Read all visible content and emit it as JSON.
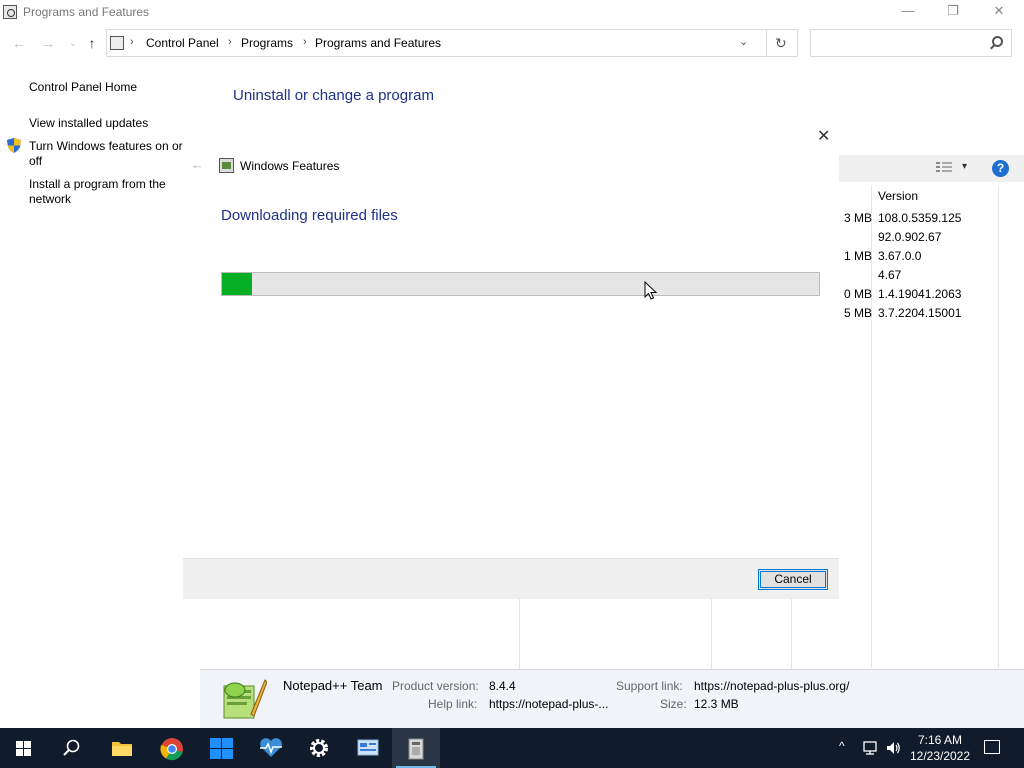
{
  "window": {
    "title": "Programs and Features",
    "minimize_glyph": "—",
    "maximize_glyph": "❐",
    "close_glyph": "✕"
  },
  "nav": {
    "back_glyph": "←",
    "forward_glyph": "→",
    "history_glyph": "⌄",
    "up_glyph": "↑"
  },
  "address": {
    "breadcrumbs": [
      "Control Panel",
      "Programs",
      "Programs and Features"
    ],
    "separator": "›",
    "dropdown_glyph": "⌄",
    "refresh_glyph": "↻"
  },
  "search": {
    "placeholder": "",
    "value": ""
  },
  "sidebar": {
    "items": [
      {
        "label": "Control Panel Home"
      },
      {
        "label": "View installed updates"
      },
      {
        "label": "Turn Windows features on or off",
        "icon": "shield-icon"
      },
      {
        "label": "Install a program from the network"
      }
    ]
  },
  "main": {
    "heading": "Uninstall or change a program",
    "columns": {
      "version": "Version"
    },
    "rows": [
      {
        "size": "3 MB",
        "version": "108.0.5359.125"
      },
      {
        "size": "",
        "version": "92.0.902.67"
      },
      {
        "size": "1 MB",
        "version": "3.67.0.0"
      },
      {
        "size": "",
        "version": "4.67"
      },
      {
        "size": "0 MB",
        "version": "1.4.19041.2063"
      },
      {
        "size": "5 MB",
        "version": "3.7.2204.15001"
      }
    ],
    "help_glyph": "?",
    "view_dropdown_glyph": "▾"
  },
  "dialog": {
    "title": "Windows Features",
    "heading": "Downloading required files",
    "progress_percent": 5,
    "cancel_label": "Cancel",
    "close_glyph": "✕",
    "back_glyph": "←"
  },
  "details": {
    "publisher": "Notepad++ Team",
    "product_version_label": "Product version:",
    "product_version": "8.4.4",
    "support_link_label": "Support link:",
    "support_link": "https://notepad-plus-plus.org/",
    "help_link_label": "Help link:",
    "help_link": "https://notepad-plus-...",
    "size_label": "Size:",
    "size": "12.3 MB"
  },
  "taskbar": {
    "apps": [
      "windows-start",
      "search",
      "file-explorer",
      "chrome",
      "start-tiles",
      "health-monitor",
      "settings",
      "control-panel",
      "programs-and-features"
    ],
    "tray_chevron": "^",
    "time": "7:16 AM",
    "date": "12/23/2022"
  },
  "colors": {
    "accent_blue": "#1e3287",
    "progress_green": "#06b025",
    "taskbar": "#101c2c"
  }
}
